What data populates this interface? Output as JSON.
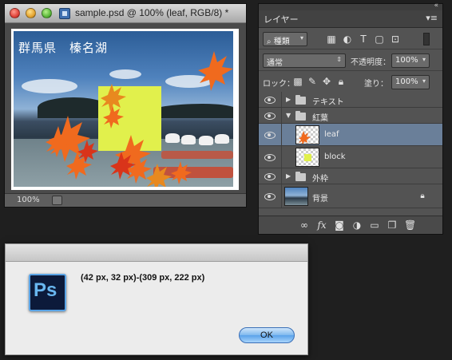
{
  "document_window": {
    "title": "sample.psd @ 100% (leaf, RGB/8) *",
    "caption": "群馬県　榛名湖",
    "zoom": "100%"
  },
  "layers_panel": {
    "tab_label": "レイヤー",
    "filter_kind": "種類",
    "blend_mode": "通常",
    "opacity_label": "不透明度：",
    "opacity_value": "100%",
    "lock_label": "ロック：",
    "fill_label": "塗り：",
    "fill_value": "100%",
    "layers": [
      {
        "name": "テキスト",
        "type": "group",
        "expanded": false
      },
      {
        "name": "紅葉",
        "type": "group",
        "expanded": true
      },
      {
        "name": "leaf",
        "type": "layer",
        "selected": true
      },
      {
        "name": "block",
        "type": "layer"
      },
      {
        "name": "外枠",
        "type": "group",
        "expanded": false
      },
      {
        "name": "背景",
        "type": "background",
        "locked": true
      }
    ],
    "bottom_fx_label": "fx"
  },
  "dialog": {
    "app_icon_text": "Ps",
    "message": "(42 px, 32 px)-(309 px, 222 px)",
    "ok_label": "OK"
  },
  "colors": {
    "selected_row": "#6a7f99",
    "block_fill": "#e1f04c",
    "leaf_orange": "#f06a1e"
  }
}
